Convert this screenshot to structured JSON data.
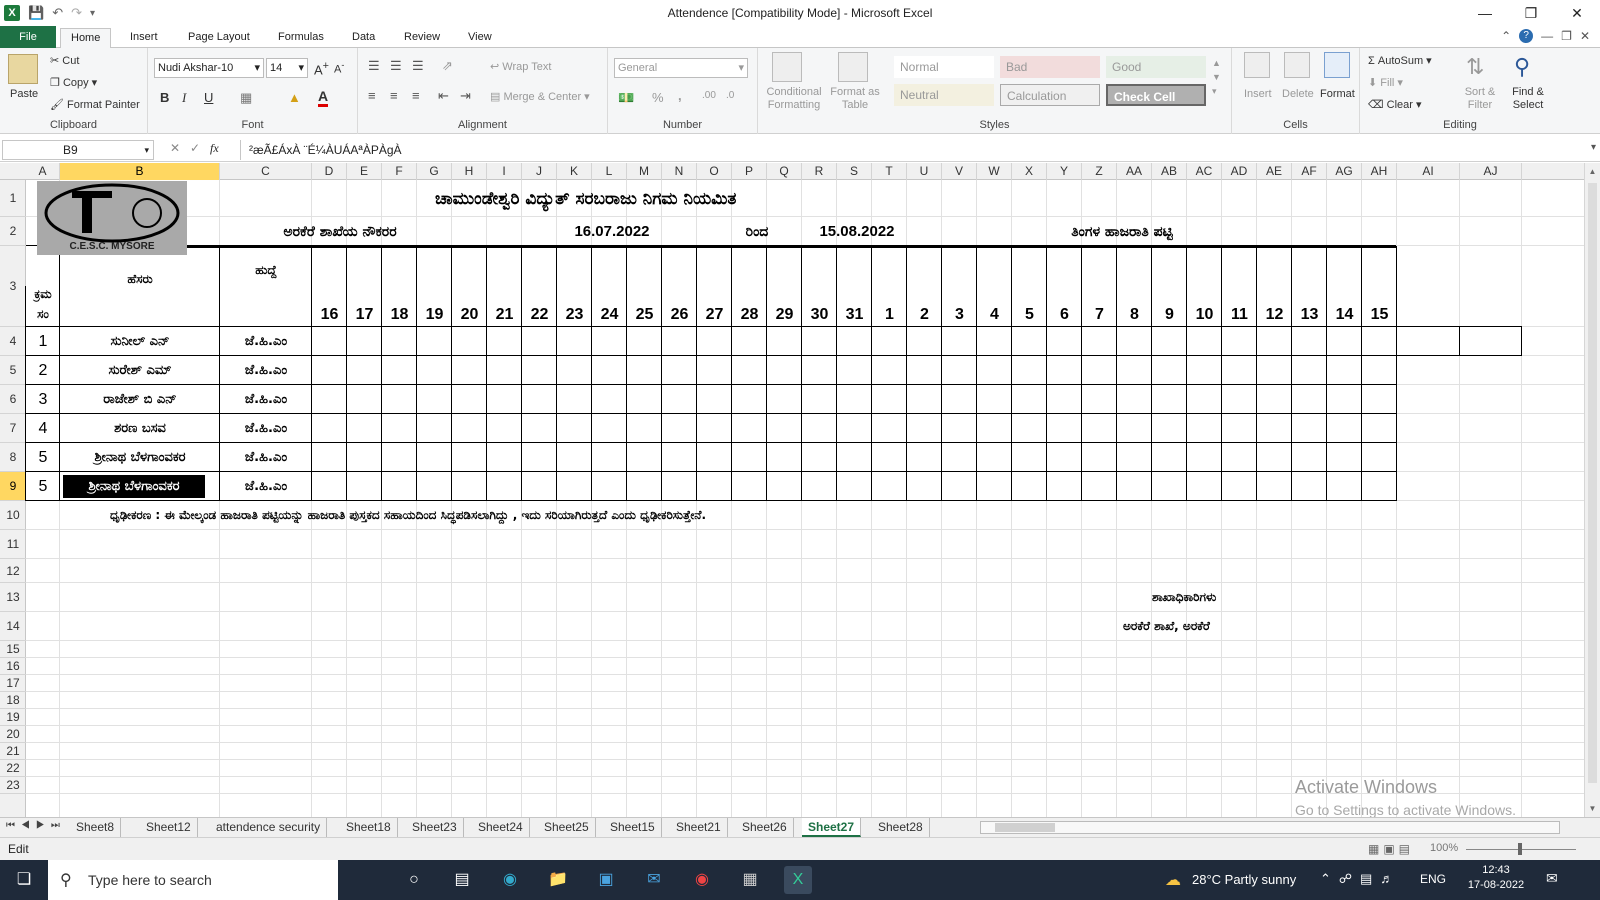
{
  "window": {
    "title": "Attendence  [Compatibility Mode]  -  Microsoft Excel"
  },
  "tabs": [
    "File",
    "Home",
    "Insert",
    "Page Layout",
    "Formulas",
    "Data",
    "Review",
    "View"
  ],
  "ribbon": {
    "clipboard": {
      "paste": "Paste",
      "cut": "Cut",
      "copy": "Copy",
      "format_painter": "Format Painter",
      "label": "Clipboard"
    },
    "font": {
      "name": "Nudi Akshar-10",
      "size": "14",
      "label": "Font",
      "bold": "B",
      "italic": "I",
      "underline": "U",
      "color_a": "A"
    },
    "alignment": {
      "wrap": "Wrap Text",
      "merge": "Merge & Center",
      "label": "Alignment"
    },
    "number": {
      "format": "General",
      "percent": "%",
      "comma": ",",
      "label": "Number"
    },
    "styles": {
      "conditional": "Conditional Formatting",
      "format_table": "Format as Table",
      "normal": "Normal",
      "bad": "Bad",
      "good": "Good",
      "neutral": "Neutral",
      "calculation": "Calculation",
      "check_cell": "Check Cell",
      "label": "Styles"
    },
    "cells": {
      "insert": "Insert",
      "delete": "Delete",
      "format": "Format",
      "label": "Cells"
    },
    "editing": {
      "autosum": "AutoSum",
      "fill": "Fill",
      "clear": "Clear",
      "sort": "Sort & Filter",
      "find": "Find & Select",
      "label": "Editing"
    }
  },
  "formula_bar": {
    "name_box": "B9",
    "fx": "fx",
    "content": "²æÃ£ÁxÀ ¨É¼ÀUÁAªÀPÀgÀ"
  },
  "columns": [
    "A",
    "B",
    "C",
    "D",
    "E",
    "F",
    "G",
    "H",
    "I",
    "J",
    "K",
    "L",
    "M",
    "N",
    "O",
    "P",
    "Q",
    "R",
    "S",
    "T",
    "U",
    "V",
    "W",
    "X",
    "Y",
    "Z",
    "AA",
    "AB",
    "AC",
    "AD",
    "AE",
    "AF",
    "AG",
    "AH",
    "AI",
    "AJ"
  ],
  "rows": [
    "1",
    "2",
    "3",
    "4",
    "5",
    "6",
    "7",
    "8",
    "9",
    "10",
    "11",
    "12",
    "13",
    "14",
    "15",
    "16",
    "17",
    "18",
    "19",
    "20",
    "21",
    "22",
    "23"
  ],
  "sheet": {
    "logo_text": "C.E.S.C. MYSORE",
    "title": "ಚಾಮುಂಡೇಶ್ವರಿ ವಿದ್ಯುತ್ ಸರಬರಾಜು ನಿಗಮ ನಿಯಮಿತ",
    "subtitle": "ಅರಕೆರೆ ಶಾಖೆಯ ನೌಕರರ",
    "date_from": "16.07.2022",
    "rinda": "ರಿಂದ",
    "date_to": "15.08.2022",
    "monthly": "ತಿಂಗಳ ಹಾಜರಾತಿ ಪಟ್ಟಿ",
    "hdr_sl1": "ಕ್ರಮ",
    "hdr_sl2": "ಸಂ",
    "hdr_name": "ಹೆಸರು",
    "hdr_desig": "ಹುದ್ದೆ",
    "days": [
      "16",
      "17",
      "18",
      "19",
      "20",
      "21",
      "22",
      "23",
      "24",
      "25",
      "26",
      "27",
      "28",
      "29",
      "30",
      "31",
      "1",
      "2",
      "3",
      "4",
      "5",
      "6",
      "7",
      "8",
      "9",
      "10",
      "11",
      "12",
      "13",
      "14",
      "15"
    ],
    "employees": [
      {
        "sl": "1",
        "name": "ಸುನೀಲ್ ಎನ್",
        "desig": "ಜೆ.ಹಿ.ಎಂ"
      },
      {
        "sl": "2",
        "name": "ಸುರೇಶ್ ಎಮ್",
        "desig": "ಜೆ.ಹಿ.ಎಂ"
      },
      {
        "sl": "3",
        "name": "ರಾಜೇಶ್ ಬಿ ಎನ್",
        "desig": "ಜೆ.ಹಿ.ಎಂ"
      },
      {
        "sl": "4",
        "name": "ಶರಣ ಬಸವ",
        "desig": "ಜೆ.ಹಿ.ಎಂ"
      },
      {
        "sl": "5",
        "name": "ಶ್ರೀನಾಥ ಬೆಳಗಾಂವಕರ",
        "desig": "ಜೆ.ಹಿ.ಎಂ"
      },
      {
        "sl": "5",
        "name": "ಶ್ರೀನಾಥ ಬೆಳಗಾಂವಕರ",
        "desig": "ಜೆ.ಹಿ.ಎಂ"
      }
    ],
    "certification": "ಧೃಢೀಕರಣ : ಈ ಮೇಲ್ಕಂಡ ಹಾಜರಾತಿ ಪಟ್ಟಿಯನ್ನು ಹಾಜರಾತಿ ಪುಸ್ತಕದ ಸಹಾಯದಿಂದ ಸಿದ್ಧಪಡಿಸಲಾಗಿದ್ದು , ಇದು ಸರಿಯಾಗಿರುತ್ತದೆ ಎಂದು ಧೃಢೀಕರಿಸುತ್ತೇನೆ.",
    "sign1": "ಶಾಖಾಧಿಕಾರಿಗಳು",
    "sign2": "ಅರಕೆರೆ ಶಾಖೆ, ಅರಕೆರೆ"
  },
  "sheet_tabs": [
    "Sheet8",
    "Sheet12",
    "attendence security",
    "Sheet18",
    "Sheet23",
    "Sheet24",
    "Sheet25",
    "Sheet15",
    "Sheet21",
    "Sheet26",
    "Sheet27",
    "Sheet28"
  ],
  "active_sheet": "Sheet27",
  "status": {
    "mode": "Edit",
    "zoom": "100%"
  },
  "watermark": {
    "line1": "Activate Windows",
    "line2": "Go to Settings to activate Windows."
  },
  "taskbar": {
    "search": "Type here to search",
    "weather": "28°C  Partly sunny",
    "lang": "ENG",
    "time": "12:43",
    "date": "17-08-2022"
  }
}
